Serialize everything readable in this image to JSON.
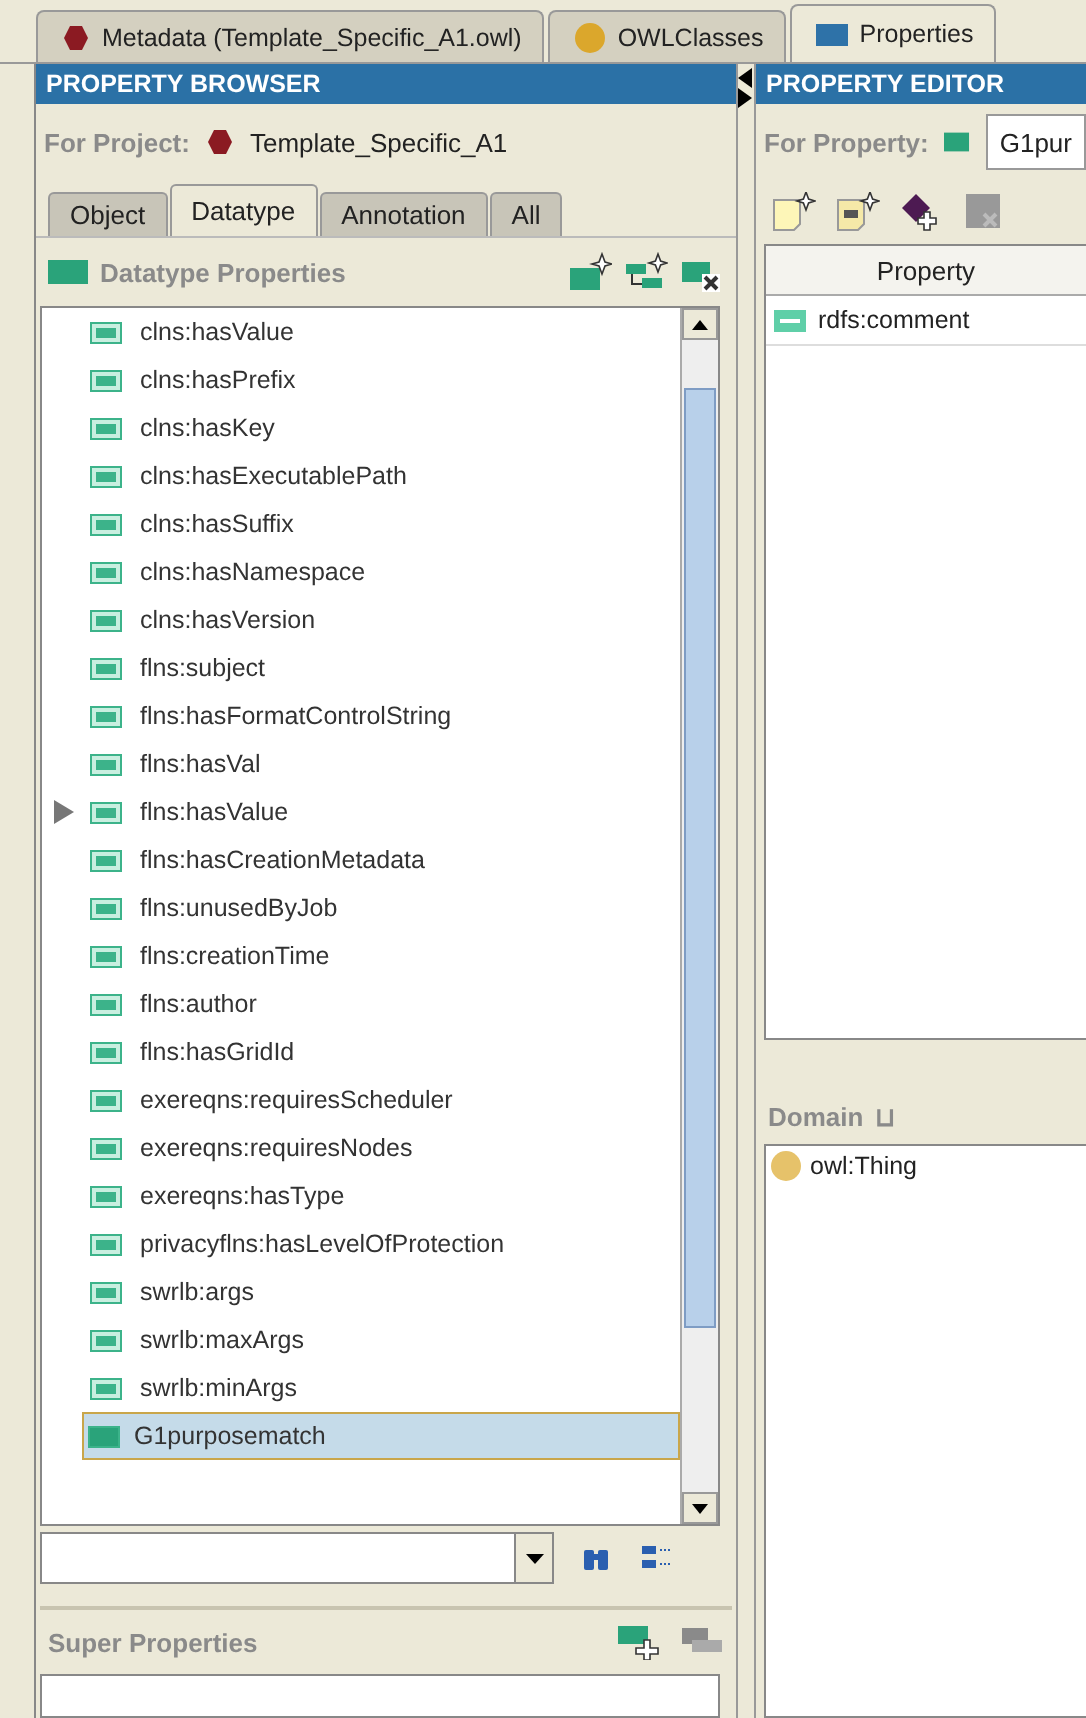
{
  "tabs": [
    {
      "label": "Metadata (Template_Specific_A1.owl)",
      "kind": "ontology",
      "selected": false
    },
    {
      "label": "OWLClasses",
      "kind": "class",
      "selected": false
    },
    {
      "label": "Properties",
      "kind": "property",
      "selected": true
    }
  ],
  "property_browser": {
    "title": "PROPERTY BROWSER",
    "project_label": "For Project:",
    "project_name": "Template_Specific_A1",
    "tabs": [
      {
        "label": "Object",
        "selected": false
      },
      {
        "label": "Datatype",
        "selected": true
      },
      {
        "label": "Annotation",
        "selected": false
      },
      {
        "label": "All",
        "selected": false
      }
    ],
    "section_title": "Datatype Properties",
    "properties": [
      {
        "label": "clns:hasValue",
        "selected": false,
        "expandable": false
      },
      {
        "label": "clns:hasPrefix",
        "selected": false,
        "expandable": false
      },
      {
        "label": "clns:hasKey",
        "selected": false,
        "expandable": false
      },
      {
        "label": "clns:hasExecutablePath",
        "selected": false,
        "expandable": false
      },
      {
        "label": "clns:hasSuffix",
        "selected": false,
        "expandable": false
      },
      {
        "label": "clns:hasNamespace",
        "selected": false,
        "expandable": false
      },
      {
        "label": "clns:hasVersion",
        "selected": false,
        "expandable": false
      },
      {
        "label": "flns:subject",
        "selected": false,
        "expandable": false
      },
      {
        "label": "flns:hasFormatControlString",
        "selected": false,
        "expandable": false
      },
      {
        "label": "flns:hasVal",
        "selected": false,
        "expandable": false
      },
      {
        "label": "flns:hasValue",
        "selected": false,
        "expandable": true
      },
      {
        "label": "flns:hasCreationMetadata",
        "selected": false,
        "expandable": false
      },
      {
        "label": "flns:unusedByJob",
        "selected": false,
        "expandable": false
      },
      {
        "label": "flns:creationTime",
        "selected": false,
        "expandable": false
      },
      {
        "label": "flns:author",
        "selected": false,
        "expandable": false
      },
      {
        "label": "flns:hasGridId",
        "selected": false,
        "expandable": false
      },
      {
        "label": "exereqns:requiresScheduler",
        "selected": false,
        "expandable": false
      },
      {
        "label": "exereqns:requiresNodes",
        "selected": false,
        "expandable": false
      },
      {
        "label": "exereqns:hasType",
        "selected": false,
        "expandable": false
      },
      {
        "label": "privacyflns:hasLevelOfProtection",
        "selected": false,
        "expandable": false
      },
      {
        "label": "swrlb:args",
        "selected": false,
        "expandable": false
      },
      {
        "label": "swrlb:maxArgs",
        "selected": false,
        "expandable": false
      },
      {
        "label": "swrlb:minArgs",
        "selected": false,
        "expandable": false
      },
      {
        "label": "G1purposematch",
        "selected": true,
        "expandable": false
      }
    ],
    "super_properties_title": "Super Properties"
  },
  "property_editor": {
    "title": "PROPERTY EDITOR",
    "property_label": "For Property:",
    "property_value": "G1pur",
    "table": {
      "columns": [
        "Property"
      ],
      "rows": [
        "rdfs:comment"
      ]
    },
    "domain_label": "Domain",
    "domain_marker": "⊔",
    "domain": [
      "owl:Thing"
    ]
  }
}
